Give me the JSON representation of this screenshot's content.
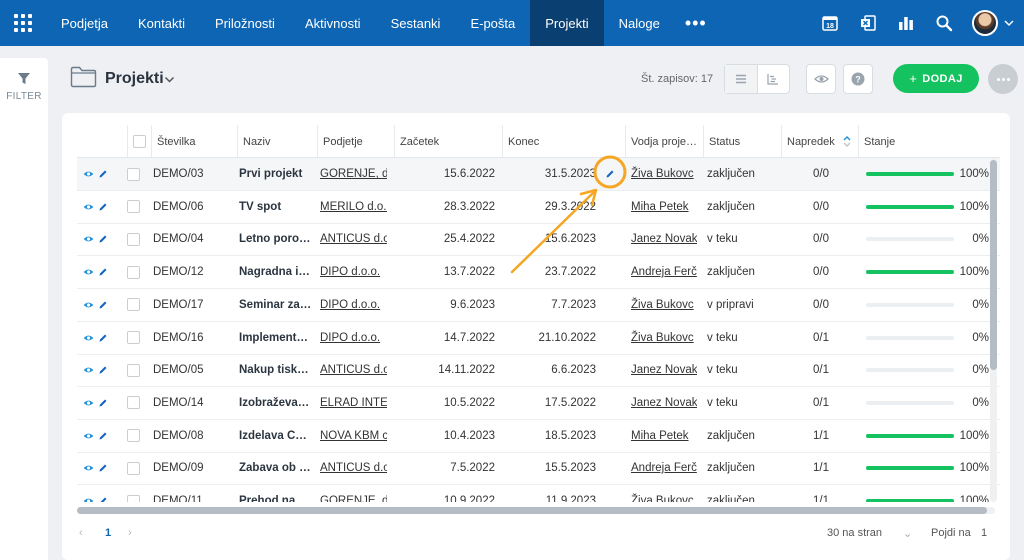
{
  "nav": {
    "items": [
      "Podjetja",
      "Kontakti",
      "Priložnosti",
      "Aktivnosti",
      "Sestanki",
      "E-pošta",
      "Projekti",
      "Naloge"
    ],
    "active_index": 6,
    "more": "•••",
    "calendar_day": "18",
    "icons": [
      "calendar-icon",
      "exchange-icon",
      "reports-icon",
      "search-icon",
      "avatar",
      "chevron-down-icon"
    ]
  },
  "sidebar": {
    "filter_label": "FILTER"
  },
  "header": {
    "title": "Projekti",
    "record_count": "Št. zapisov: 17",
    "add_label": "DODAJ",
    "add_icon": "+"
  },
  "table": {
    "columns": [
      "Številka",
      "Naziv",
      "Podjetje",
      "Začetek",
      "Konec",
      "Vodja proje…",
      "Status",
      "Napredek",
      "Stanje"
    ],
    "rows": [
      {
        "num": "DEMO/03",
        "name": "Prvi projekt",
        "company": "GORENJE, d",
        "start": "15.6.2022",
        "end": "31.5.2023",
        "lead": "Živa Bukovc",
        "status": "zaključen",
        "progress": "0/0",
        "fill": 1,
        "pct": "100%"
      },
      {
        "num": "DEMO/06",
        "name": "TV spot",
        "company": "MERILO d.o.o",
        "start": "28.3.2022",
        "end": "29.3.2022",
        "lead": "Miha Petek",
        "status": "zaključen",
        "progress": "0/0",
        "fill": 1,
        "pct": "100%"
      },
      {
        "num": "DEMO/04",
        "name": "Letno poro…",
        "company": "ANTICUS d.o",
        "start": "25.4.2022",
        "end": "15.6.2023",
        "lead": "Janez Novak",
        "status": "v teku",
        "progress": "0/0",
        "fill": 0,
        "pct": "0%"
      },
      {
        "num": "DEMO/12",
        "name": "Nagradna i…",
        "company": "DIPO d.o.o.",
        "start": "13.7.2022",
        "end": "23.7.2022",
        "lead": "Andreja Ferč",
        "status": "zaključen",
        "progress": "0/0",
        "fill": 1,
        "pct": "100%"
      },
      {
        "num": "DEMO/17",
        "name": "Seminar za…",
        "company": "DIPO d.o.o.",
        "start": "9.6.2023",
        "end": "7.7.2023",
        "lead": "Živa Bukovc",
        "status": "v pripravi",
        "progress": "0/0",
        "fill": 0,
        "pct": "0%"
      },
      {
        "num": "DEMO/16",
        "name": "Implement…",
        "company": "DIPO d.o.o.",
        "start": "14.7.2022",
        "end": "21.10.2022",
        "lead": "Živa Bukovc",
        "status": "v teku",
        "progress": "0/1",
        "fill": 0,
        "pct": "0%"
      },
      {
        "num": "DEMO/05",
        "name": "Nakup tisk…",
        "company": "ANTICUS d.o",
        "start": "14.11.2022",
        "end": "6.6.2023",
        "lead": "Janez Novak",
        "status": "v teku",
        "progress": "0/1",
        "fill": 0,
        "pct": "0%"
      },
      {
        "num": "DEMO/14",
        "name": "Izobraževa…",
        "company": "ELRAD INTE",
        "start": "10.5.2022",
        "end": "17.5.2022",
        "lead": "Janez Novak",
        "status": "v teku",
        "progress": "0/1",
        "fill": 0,
        "pct": "0%"
      },
      {
        "num": "DEMO/08",
        "name": "Izdelava C…",
        "company": "NOVA KBM c",
        "start": "10.4.2023",
        "end": "18.5.2023",
        "lead": "Miha Petek",
        "status": "zaključen",
        "progress": "1/1",
        "fill": 1,
        "pct": "100%"
      },
      {
        "num": "DEMO/09",
        "name": "Zabava ob …",
        "company": "ANTICUS d.o",
        "start": "7.5.2022",
        "end": "15.5.2023",
        "lead": "Andreja Ferč",
        "status": "zaključen",
        "progress": "1/1",
        "fill": 1,
        "pct": "100%"
      },
      {
        "num": "DEMO/11",
        "name": "Prehod na …",
        "company": "GORENJE, d",
        "start": "10.9.2022",
        "end": "11.9.2023",
        "lead": "Živa Bukovc",
        "status": "zaključen",
        "progress": "1/1",
        "fill": 1,
        "pct": "100%"
      }
    ]
  },
  "pager": {
    "prev": "‹",
    "page": "1",
    "next": "›",
    "page_size": "30 na stran",
    "jump_label": "Pojdi na",
    "jump_value": "1"
  },
  "colors": {
    "nav_bg": "#0d65b3",
    "nav_active": "#0a3f72",
    "accent_green": "#14c35f",
    "highlight_orange": "#f5a623",
    "link_blue": "#1e8fd8"
  }
}
